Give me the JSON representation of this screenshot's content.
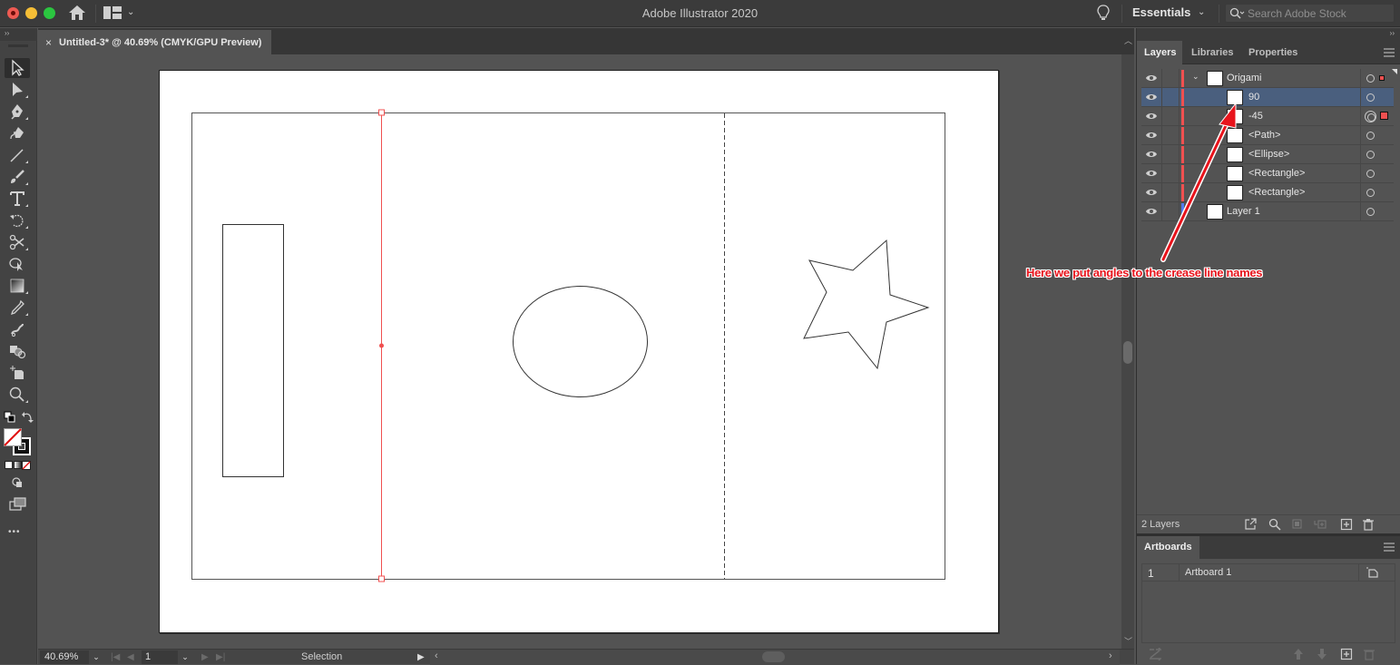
{
  "window": {
    "app_title": "Adobe Illustrator 2020",
    "workspace_label": "Essentials",
    "search_placeholder": "Search Adobe Stock"
  },
  "document_tab": {
    "close_glyph": "×",
    "title": "Untitled-3* @ 40.69% (CMYK/GPU Preview)"
  },
  "toolbar": {
    "collapse_glyph": "››",
    "tools": [
      {
        "name": "selection-tool",
        "active": true
      },
      {
        "name": "direct-selection-tool"
      },
      {
        "name": "pen-tool"
      },
      {
        "name": "curvature-tool"
      },
      {
        "name": "line-segment-tool"
      },
      {
        "name": "paintbrush-tool"
      },
      {
        "name": "type-tool"
      },
      {
        "name": "rotate-tool"
      },
      {
        "name": "scissors-tool"
      },
      {
        "name": "shape-builder-tool"
      },
      {
        "name": "gradient-tool"
      },
      {
        "name": "eyedropper-tool"
      },
      {
        "name": "puppet-warp-tool"
      },
      {
        "name": "blend-tool"
      },
      {
        "name": "artboard-tool"
      },
      {
        "name": "zoom-tool"
      }
    ],
    "more_glyph": "•••"
  },
  "status_bar": {
    "zoom_value": "40.69%",
    "artboard_number": "1",
    "current_tool": "Selection",
    "first_glyph": "|◀",
    "prev_glyph": "◀",
    "next_glyph": "▶",
    "last_glyph": "▶|",
    "play_glyph": "▶",
    "scroll_left_glyph": "‹",
    "scroll_right_glyph": "›",
    "dropdown_glyph": "⌄"
  },
  "panels": {
    "collapse_glyph": "››",
    "tabs": [
      {
        "label": "Layers",
        "active": true
      },
      {
        "label": "Libraries",
        "active": false
      },
      {
        "label": "Properties",
        "active": false
      }
    ],
    "layers": {
      "rows": [
        {
          "name": "Origami",
          "level": 0,
          "expanded": true,
          "color": "#f05050",
          "selected": false,
          "target": "single",
          "selection_marker": "small"
        },
        {
          "name": "90",
          "level": 1,
          "color": "#f05050",
          "selected": true,
          "target": "single"
        },
        {
          "name": "-45",
          "level": 1,
          "color": "#f05050",
          "selected": false,
          "target": "double",
          "selection_marker": "large"
        },
        {
          "name": "<Path>",
          "level": 1,
          "color": "#f05050",
          "selected": false,
          "target": "single"
        },
        {
          "name": "<Ellipse>",
          "level": 1,
          "color": "#f05050",
          "selected": false,
          "target": "single"
        },
        {
          "name": "<Rectangle>",
          "level": 1,
          "color": "#f05050",
          "selected": false,
          "target": "single"
        },
        {
          "name": "<Rectangle>",
          "level": 1,
          "color": "#f05050",
          "selected": false,
          "target": "single"
        },
        {
          "name": "Layer 1",
          "level": 0,
          "color": "#4f7bf0",
          "selected": false,
          "target": "single"
        }
      ],
      "count_label": "2 Layers"
    },
    "artboards": {
      "tab_label": "Artboards",
      "rows": [
        {
          "number": "1",
          "name": "Artboard 1"
        }
      ]
    }
  },
  "annotation": {
    "text": "Here we put angles to the crease line names",
    "color": "#e8141c"
  },
  "artwork": {
    "stroke_color": "#333333",
    "selection_color": "#f05050"
  }
}
